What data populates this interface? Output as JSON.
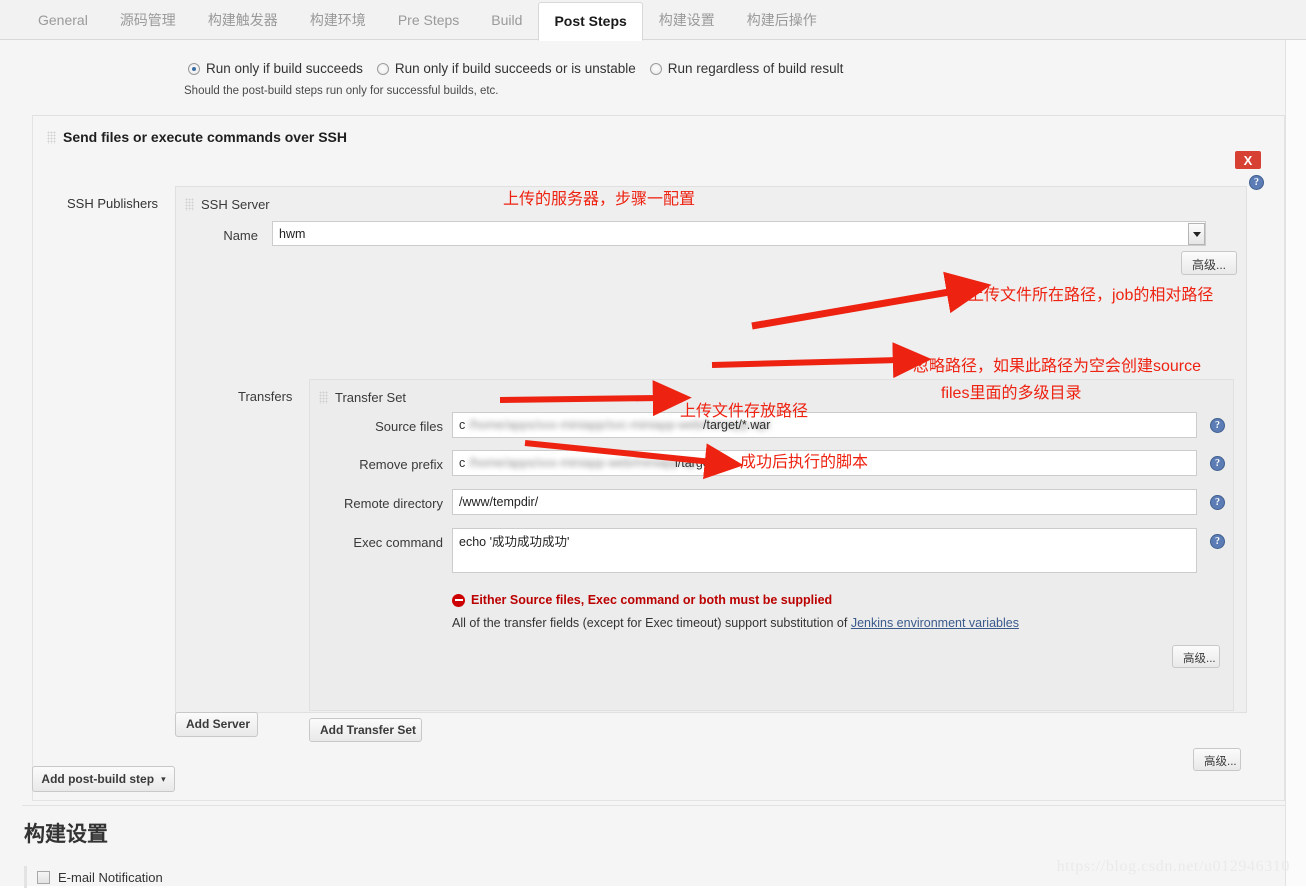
{
  "tabs": [
    {
      "label": "General",
      "active": false
    },
    {
      "label": "源码管理",
      "active": false
    },
    {
      "label": "构建触发器",
      "active": false
    },
    {
      "label": "构建环境",
      "active": false
    },
    {
      "label": "Pre Steps",
      "active": false
    },
    {
      "label": "Build",
      "active": false
    },
    {
      "label": "Post Steps",
      "active": true
    },
    {
      "label": "构建设置",
      "active": false
    },
    {
      "label": "构建后操作",
      "active": false
    }
  ],
  "run_options": [
    {
      "label": "Run only if build succeeds",
      "checked": true
    },
    {
      "label": "Run only if build succeeds or is unstable",
      "checked": false
    },
    {
      "label": "Run regardless of build result",
      "checked": false
    }
  ],
  "run_hint": "Should the post-build steps run only for successful builds, etc.",
  "block": {
    "title": "Send files or execute commands over SSH",
    "close_label": "X",
    "help_glyph": "?",
    "ssh_publishers_label": "SSH Publishers",
    "advanced_label": "高级...",
    "add_post_build_step_label": "Add post-build step",
    "add_post_build_step_caret": "▾"
  },
  "server": {
    "panel_title": "SSH Server",
    "name_label": "Name",
    "name_value": "hwm",
    "advanced_label": "高级...",
    "add_server_label": "Add Server",
    "transfers_label": "Transfers"
  },
  "transfer_set": {
    "panel_title": "Transfer Set",
    "fields": [
      {
        "label": "Source files",
        "blurred_prefix": "c",
        "blurred_body": "/home/apps/xxx-miniapp/svc-miniapp-web/miniapp-api",
        "visible_suffix": "/target/*.war"
      },
      {
        "label": "Remove prefix",
        "blurred_prefix": "c",
        "blurred_body": "/home/apps/xxx-miniapp-web/miniapp-ap",
        "visible_suffix": "i/target"
      },
      {
        "label": "Remote directory",
        "value": "/www/tempdir/"
      },
      {
        "label": "Exec command",
        "value": "echo '成功成功成功'"
      }
    ],
    "error_message": "Either Source files, Exec command or both must be supplied",
    "note_prefix": "All of the transfer fields (except for Exec timeout) support substitution of ",
    "note_link": "Jenkins environment variables",
    "advanced_label": "高级...",
    "add_transfer_set_label": "Add Transfer Set"
  },
  "build_settings": {
    "heading": "构建设置",
    "email_notification_label": "E-mail Notification"
  },
  "annotations": [
    {
      "id": "name-anno",
      "text": "上传的服务器，步骤一配置"
    },
    {
      "id": "source-anno",
      "text": "上传文件所在路径，job的相对路径"
    },
    {
      "id": "prefix-anno-1",
      "text": "忽略路径，如果此路径为空会创建source"
    },
    {
      "id": "prefix-anno-2",
      "text": "files里面的多级目录"
    },
    {
      "id": "remote-anno",
      "text": "上传文件存放路径"
    },
    {
      "id": "exec-anno",
      "text": "成功后执行的脚本"
    }
  ],
  "watermark": "https://blog.csdn.net/u012946310",
  "colors": {
    "annotation_red": "#ee2211",
    "error_red": "#bb0000",
    "close_button": "#d64134",
    "page_bg": "#f5f5f5",
    "link_blue": "#3a5a8c"
  }
}
